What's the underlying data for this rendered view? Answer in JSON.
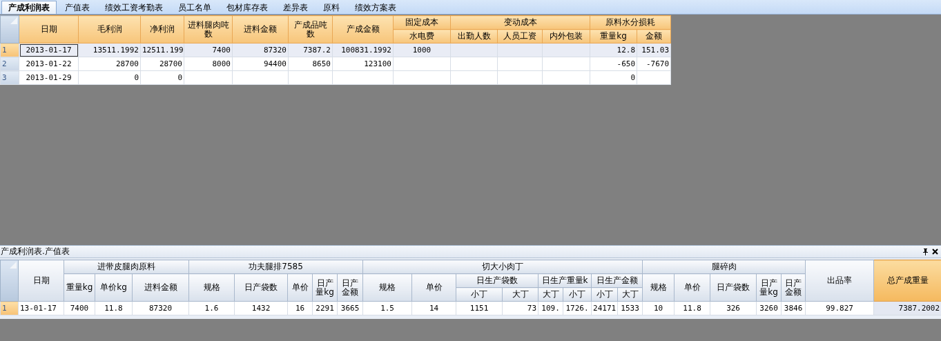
{
  "tabs": [
    {
      "label": "产成利润表",
      "selected": true
    },
    {
      "label": "产值表",
      "selected": false
    },
    {
      "label": "绩效工资考勤表",
      "selected": false
    },
    {
      "label": "员工名单",
      "selected": false
    },
    {
      "label": "包材库存表",
      "selected": false
    },
    {
      "label": "差异表",
      "selected": false
    },
    {
      "label": "原料",
      "selected": false
    },
    {
      "label": "绩效方案表",
      "selected": false
    }
  ],
  "top_grid": {
    "columns": [
      {
        "label": "日期"
      },
      {
        "label": "毛利润"
      },
      {
        "label": "净利润"
      },
      {
        "label": "进料腿肉吨数"
      },
      {
        "label": "进料金额"
      },
      {
        "label": "产成品吨数"
      },
      {
        "label": "产成金额"
      },
      {
        "label": "固定成本",
        "children": [
          {
            "label": "水电费"
          }
        ]
      },
      {
        "label": "变动成本",
        "colspan": 3,
        "children": [
          {
            "label": "出勤人数"
          },
          {
            "label": "人员工资"
          },
          {
            "label": "内外包装"
          }
        ]
      },
      {
        "label": "原料水分损耗",
        "colspan": 2,
        "children": [
          {
            "label": "重量kg"
          },
          {
            "label": "金额"
          }
        ]
      }
    ],
    "rows": [
      {
        "number": "1",
        "selected": true,
        "cells": [
          "2013-01-17",
          "13511.1992",
          "12511.199",
          "7400",
          "87320",
          "7387.2",
          "100831.1992",
          "1000",
          null,
          null,
          null,
          "12.8",
          "151.03"
        ]
      },
      {
        "number": "2",
        "selected": false,
        "cells": [
          "2013-01-22",
          "28700",
          "28700",
          "8000",
          "94400",
          "8650",
          "123100",
          null,
          null,
          null,
          null,
          "-650",
          "-7670"
        ]
      },
      {
        "number": "3",
        "selected": false,
        "cells": [
          "2013-01-29",
          "0",
          "0",
          null,
          null,
          null,
          null,
          null,
          null,
          null,
          null,
          "0",
          null
        ]
      }
    ]
  },
  "bottom_panel": {
    "title": "产成利润表.产值表",
    "columns": [
      {
        "label": "日期",
        "selected": false
      },
      {
        "label": "进带皮腿肉原料",
        "selected": false,
        "colspan": 3,
        "children": [
          {
            "label": "重量kg",
            "selected": false
          },
          {
            "label": "单价kg",
            "selected": false
          },
          {
            "label": "进料金额",
            "selected": false
          }
        ]
      },
      {
        "label": "功夫腿排7585",
        "selected": false,
        "colspan": 5,
        "children": [
          {
            "label": "规格",
            "selected": false
          },
          {
            "label": "日产袋数",
            "selected": false
          },
          {
            "label": "单价",
            "selected": false
          },
          {
            "label": "日产量kg",
            "selected": false
          },
          {
            "label": "日产金额",
            "selected": false
          }
        ]
      },
      {
        "label": "切大小肉丁",
        "selected": false,
        "colspan": 8,
        "children": [
          {
            "label": "规格",
            "selected": false
          },
          {
            "label": "单价",
            "selected": false
          },
          {
            "label": "日生产袋数",
            "selected": false,
            "colspan": 2,
            "children": [
              {
                "label": "小丁",
                "selected": false
              },
              {
                "label": "大丁",
                "selected": false
              }
            ]
          },
          {
            "label": "日生产重量k",
            "selected": false,
            "colspan": 2,
            "children": [
              {
                "label": "大丁",
                "selected": false
              },
              {
                "label": "小丁",
                "selected": false
              }
            ]
          },
          {
            "label": "日生产金额",
            "selected": false,
            "colspan": 2,
            "children": [
              {
                "label": "小丁",
                "selected": false
              },
              {
                "label": "大丁",
                "selected": false
              }
            ]
          }
        ]
      },
      {
        "label": "腿碎肉",
        "selected": false,
        "colspan": 5,
        "children": [
          {
            "label": "规格",
            "selected": false
          },
          {
            "label": "单价",
            "selected": false
          },
          {
            "label": "日产袋数",
            "selected": false
          },
          {
            "label": "日产量kg",
            "selected": false
          },
          {
            "label": "日产金额",
            "selected": false
          }
        ]
      },
      {
        "label": "出品率",
        "selected": false
      },
      {
        "label": "总产成重量",
        "selected": true
      }
    ],
    "rows": [
      {
        "number": "1",
        "selected": true,
        "cells": [
          "13-01-17",
          "7400",
          "11.8",
          "87320",
          "1.6",
          "1432",
          "16",
          "2291",
          "3665",
          "1.5",
          "14",
          "1151",
          "73",
          "109.",
          "1726.",
          "24171",
          "1533",
          "10",
          "11.8",
          "326",
          "3260",
          "3846",
          "99.827",
          "7387.2002"
        ]
      }
    ]
  }
}
